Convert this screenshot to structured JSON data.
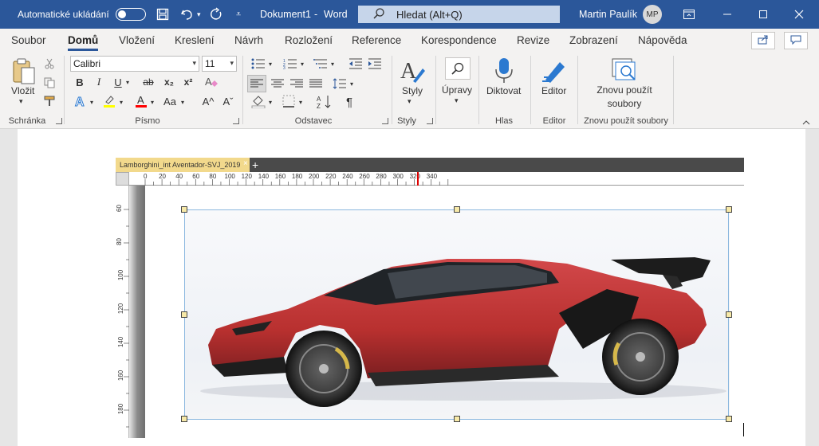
{
  "titlebar": {
    "autosave_label": "Automatické ukládání",
    "doc_title": "Dokument1",
    "separator": "-",
    "app_name": "Word",
    "search_placeholder": "Hledat (Alt+Q)",
    "user_name": "Martin Paulík",
    "user_initials": "MP"
  },
  "menu": {
    "tabs": [
      "Soubor",
      "Domů",
      "Vložení",
      "Kreslení",
      "Návrh",
      "Rozložení",
      "Reference",
      "Korespondence",
      "Revize",
      "Zobrazení",
      "Nápověda"
    ],
    "active": "Domů"
  },
  "ribbon": {
    "paste_label": "Vložit",
    "font_name": "Calibri",
    "font_size": "11",
    "styles_label": "Styly",
    "editing_label": "Úpravy",
    "dictate_label": "Diktovat",
    "editor_label": "Editor",
    "reuse_label_1": "Znovu použít",
    "reuse_label_2": "soubory",
    "groups": {
      "clipboard": "Schránka",
      "font": "Písmo",
      "paragraph": "Odstavec",
      "styles": "Styly",
      "voice": "Hlas",
      "editor": "Editor",
      "reuse": "Znovu použít soubory"
    },
    "glyphs": {
      "bold": "B",
      "italic": "I",
      "underline": "U",
      "strike": "ab",
      "subscript": "x₂",
      "superscript": "x²",
      "pilcrow": "¶",
      "grow": "A^",
      "shrink": "Aˇ",
      "case": "Aa"
    }
  },
  "embedded": {
    "tab_title": "Lamborghini_int Aventador-SVJ_2019",
    "close_glyph": "×",
    "plus_glyph": "+",
    "ruler_h": [
      "0",
      "20",
      "40",
      "60",
      "80",
      "100",
      "120",
      "140",
      "160",
      "180",
      "200",
      "220",
      "240",
      "260",
      "280",
      "300",
      "320",
      "340"
    ],
    "ruler_v": [
      "60",
      "80",
      "100",
      "120",
      "140",
      "160",
      "180"
    ]
  },
  "colors": {
    "brand": "#2b579a",
    "car_body": "#c0393b",
    "highlight": "#ffff00",
    "font_color": "#ff0000",
    "handle_fill": "#f7e9a8"
  },
  "icons": [
    "save-icon",
    "undo-icon",
    "redo-icon",
    "customize-icon",
    "search-icon",
    "ribbon-display-icon",
    "minimize-icon",
    "maximize-icon",
    "close-icon",
    "share-icon",
    "comments-icon",
    "paste-icon",
    "cut-icon",
    "copy-icon",
    "format-painter-icon",
    "microphone-icon",
    "editor-pen-icon",
    "reuse-files-icon",
    "styles-icon",
    "find-icon"
  ]
}
